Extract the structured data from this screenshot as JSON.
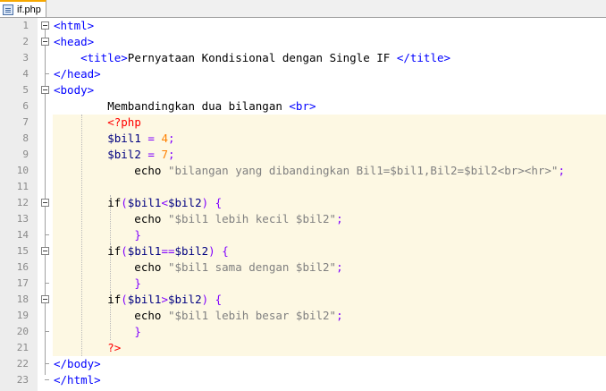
{
  "tab": {
    "label": "if.php",
    "icon": "php-file-icon"
  },
  "lines": [
    {
      "n": "1",
      "t": "<html>"
    },
    {
      "n": "2",
      "t": "<head>"
    },
    {
      "n": "3",
      "t": "    <title>Pernyataan Kondisional dengan Single IF </title>"
    },
    {
      "n": "4",
      "t": "</head>"
    },
    {
      "n": "5",
      "t": "<body>"
    },
    {
      "n": "6",
      "t": "        Membandingkan dua bilangan <br>"
    },
    {
      "n": "7",
      "t": "        <?php"
    },
    {
      "n": "8",
      "t": "        $bil1 = 4;"
    },
    {
      "n": "9",
      "t": "        $bil2 = 7;"
    },
    {
      "n": "10",
      "t": "            echo \"bilangan yang dibandingkan Bil1=$bil1,Bil2=$bil2<br><hr>\";"
    },
    {
      "n": "11",
      "t": ""
    },
    {
      "n": "12",
      "t": "        if($bil1<$bil2) {"
    },
    {
      "n": "13",
      "t": "            echo \"$bil1 lebih kecil $bil2\";"
    },
    {
      "n": "14",
      "t": "            }"
    },
    {
      "n": "15",
      "t": "        if($bil1==$bil2) {"
    },
    {
      "n": "16",
      "t": "            echo \"$bil1 sama dengan $bil2\";"
    },
    {
      "n": "17",
      "t": "            }"
    },
    {
      "n": "18",
      "t": "        if($bil1>$bil2) {"
    },
    {
      "n": "19",
      "t": "            echo \"$bil1 lebih besar $bil2\";"
    },
    {
      "n": "20",
      "t": "            }"
    },
    {
      "n": "21",
      "t": "        ?>"
    },
    {
      "n": "22",
      "t": "</body>"
    },
    {
      "n": "23",
      "t": "</html>"
    }
  ]
}
